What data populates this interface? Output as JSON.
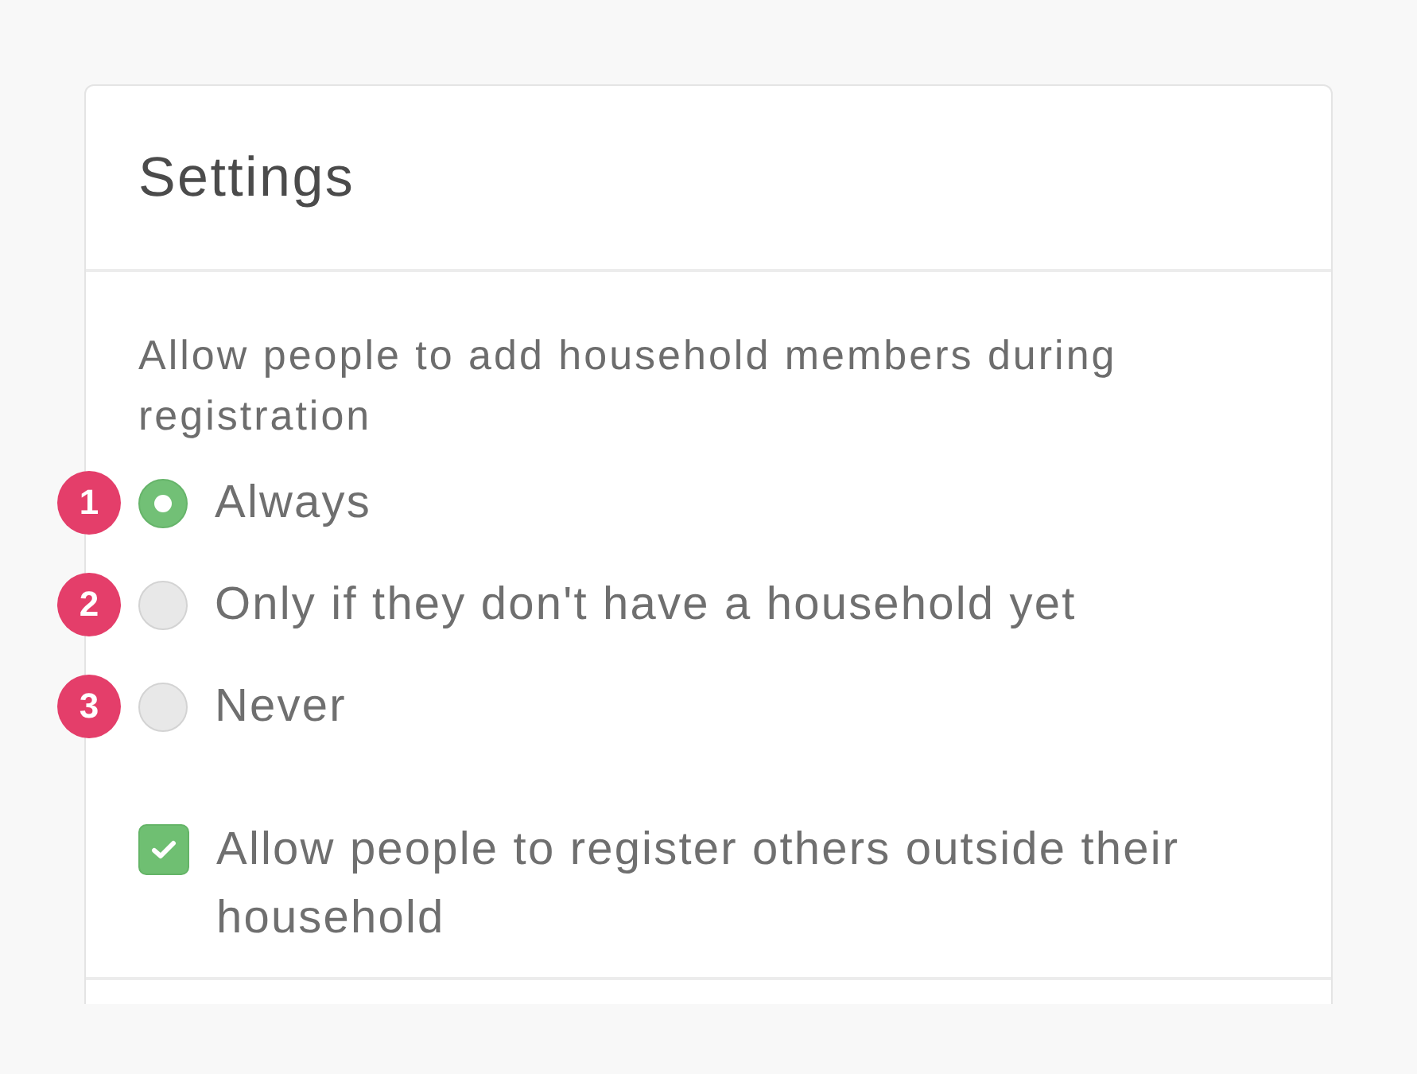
{
  "card": {
    "title": "Settings"
  },
  "household_setting": {
    "label": "Allow people to add household members during registration",
    "options": [
      {
        "label": "Always",
        "selected": true,
        "badge": "1"
      },
      {
        "label": "Only if they don't have a household yet",
        "selected": false,
        "badge": "2"
      },
      {
        "label": "Never",
        "selected": false,
        "badge": "3"
      }
    ]
  },
  "register_others": {
    "label": "Allow people to register others outside their household",
    "checked": true
  }
}
